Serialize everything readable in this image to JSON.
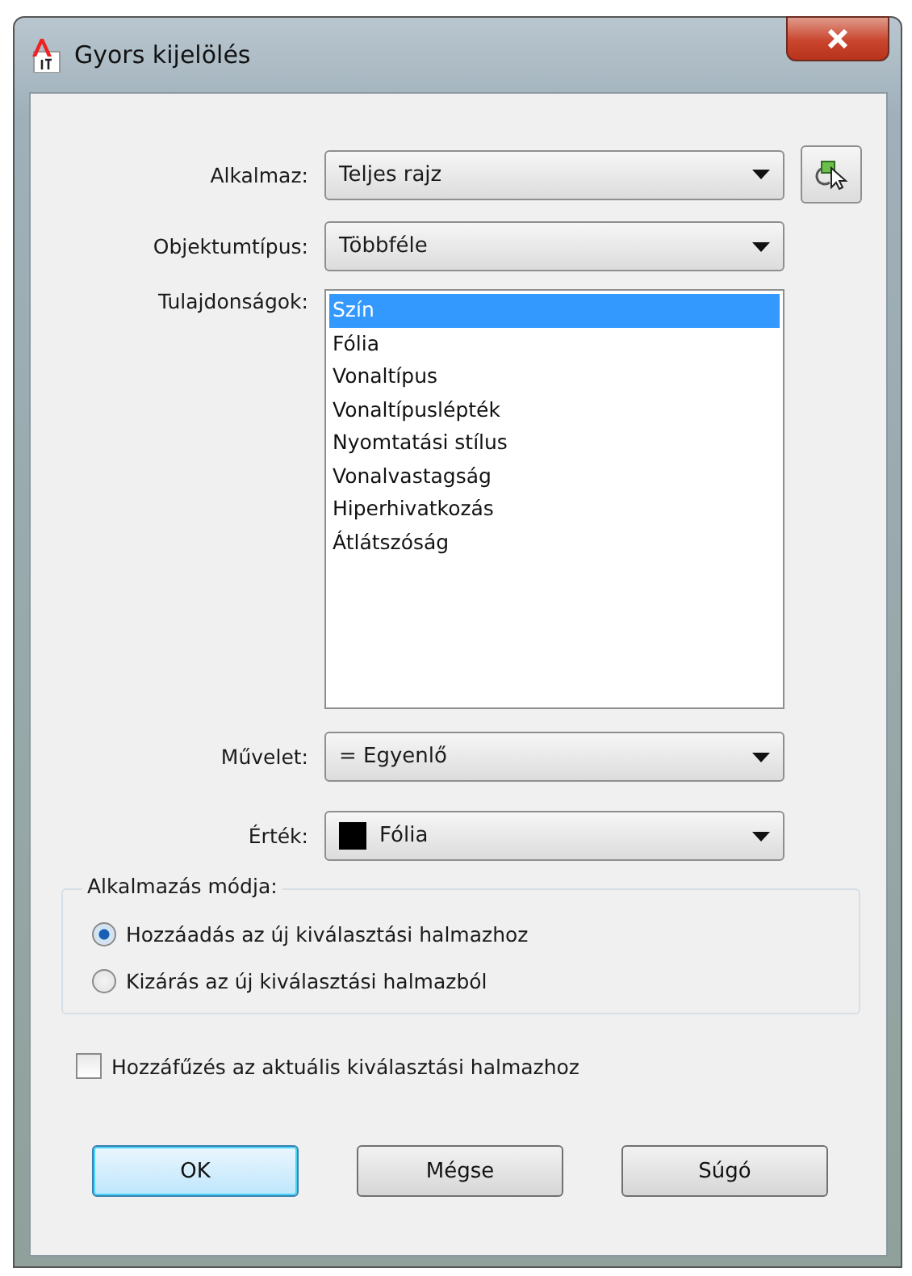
{
  "window": {
    "title": "Gyors kijelölés"
  },
  "fields": [
    {
      "label": "Alkalmaz:",
      "value": "Teljes rajz",
      "pick_button": true
    },
    {
      "label": "Objektumtípus:",
      "value": "Többféle",
      "pick_button": false
    }
  ],
  "properties": {
    "label": "Tulajdonságok:",
    "items": [
      {
        "text": "Szín",
        "selected": true
      },
      {
        "text": "Fólia",
        "selected": false
      },
      {
        "text": "Vonaltípus",
        "selected": false
      },
      {
        "text": "Vonaltípuslépték",
        "selected": false
      },
      {
        "text": "Nyomtatási stílus",
        "selected": false
      },
      {
        "text": "Vonalvastagság",
        "selected": false
      },
      {
        "text": "Hiperhivatkozás",
        "selected": false
      },
      {
        "text": "Átlátszóság",
        "selected": false
      }
    ]
  },
  "operator": {
    "label": "Művelet:",
    "value": "= Egyenlő"
  },
  "value": {
    "label": "Érték:",
    "value": "Fólia"
  },
  "apply_mode": {
    "title": "Alkalmazás módja:",
    "options": [
      {
        "label": "Hozzáadás az új kiválasztási halmazhoz",
        "selected": true
      },
      {
        "label": "Kizárás az új kiválasztási halmazból",
        "selected": false
      }
    ]
  },
  "append": {
    "label": "Hozzáfűzés az aktuális kiválasztási halmazhoz",
    "checked": false
  },
  "buttons": [
    {
      "label": "OK",
      "default": true
    },
    {
      "label": "Mégse",
      "default": false
    },
    {
      "label": "Súgó",
      "default": false
    }
  ]
}
